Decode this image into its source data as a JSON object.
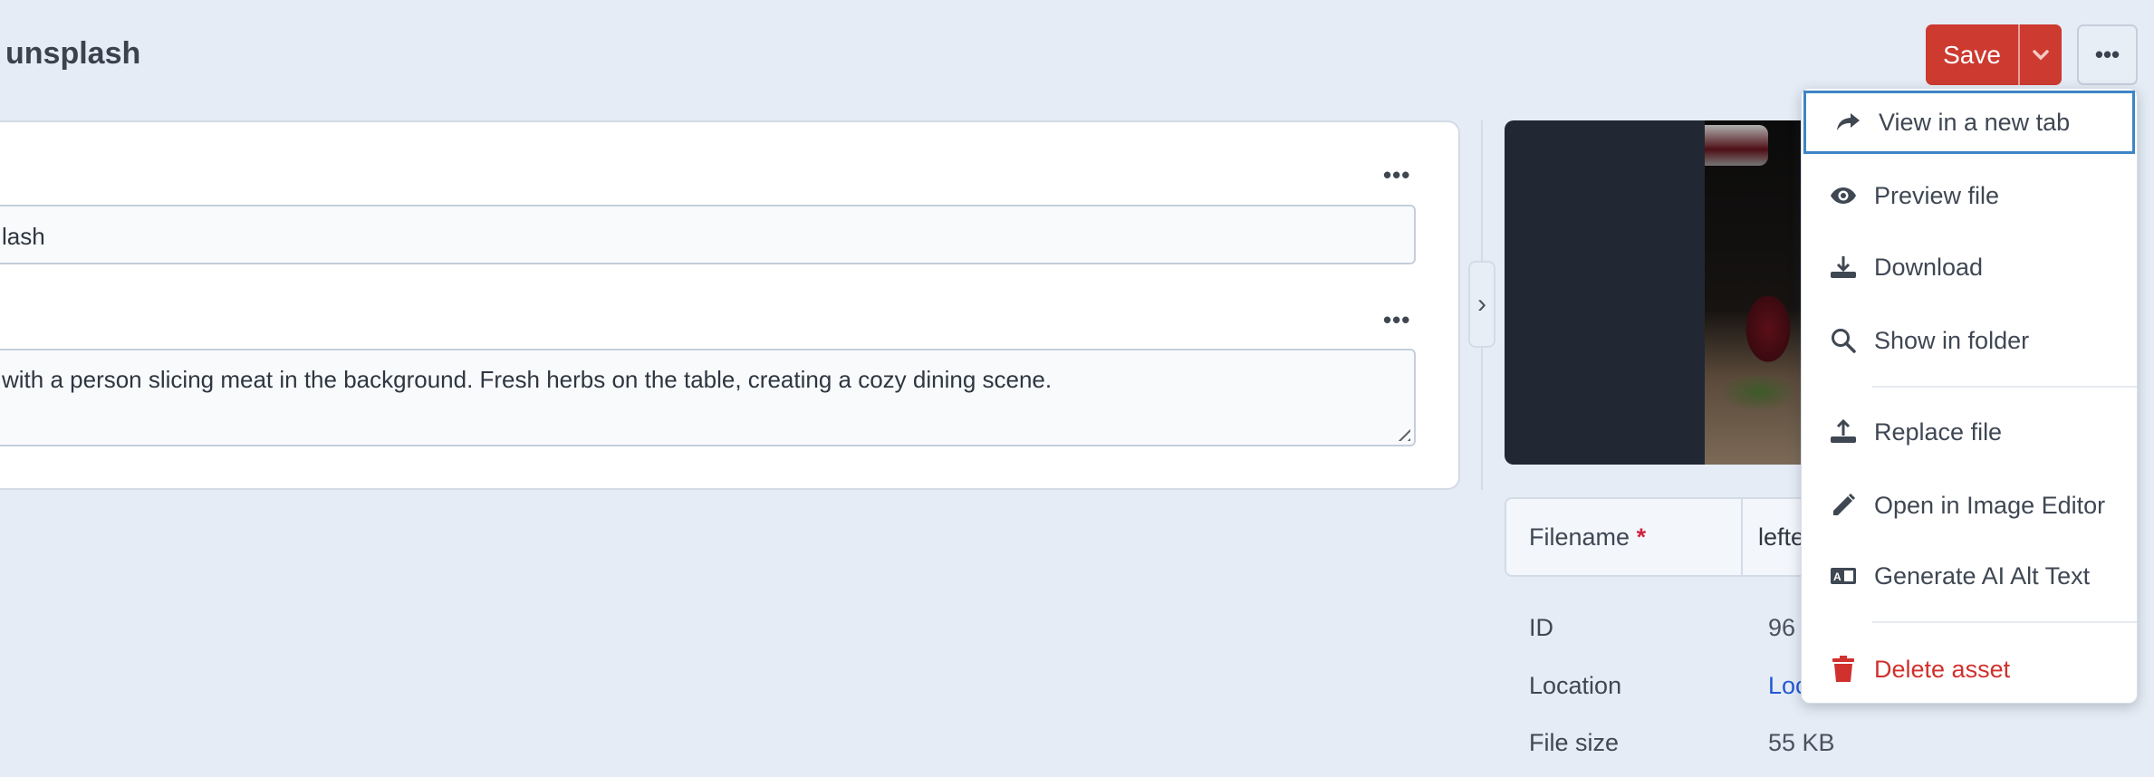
{
  "header": {
    "title": "unsplash",
    "save_label": "Save",
    "more_label": "•••"
  },
  "form": {
    "field1_value": "lash",
    "field2_value": "with a person slicing meat in the background. Fresh herbs on the table, creating a cozy dining scene.",
    "field_menu_label": "•••"
  },
  "sidebar": {
    "collapse_label": "›",
    "filename_label": "Filename",
    "required_mark": "*",
    "filename_value": "lefte",
    "meta": [
      {
        "label": "ID",
        "value": "96"
      },
      {
        "label": "Location",
        "value": "Loc"
      },
      {
        "label": "File size",
        "value": "55 KB"
      }
    ]
  },
  "menu": {
    "items": [
      {
        "label": "View in a new tab",
        "icon": "share-arrow-icon"
      },
      {
        "label": "Preview file",
        "icon": "eye-icon"
      },
      {
        "label": "Download",
        "icon": "download-icon"
      },
      {
        "label": "Show in folder",
        "icon": "search-icon"
      },
      {
        "label": "Replace file",
        "icon": "upload-icon"
      },
      {
        "label": "Open in Image Editor",
        "icon": "pencil-icon"
      },
      {
        "label": "Generate AI Alt Text",
        "icon": "alt-text-icon"
      },
      {
        "label": "Delete asset",
        "icon": "trash-icon"
      }
    ]
  },
  "colors": {
    "accent": "#cc3a30",
    "danger": "#d0312d",
    "link": "#2458d6",
    "focus": "#3d85c6",
    "background": "#e5ecf5"
  }
}
